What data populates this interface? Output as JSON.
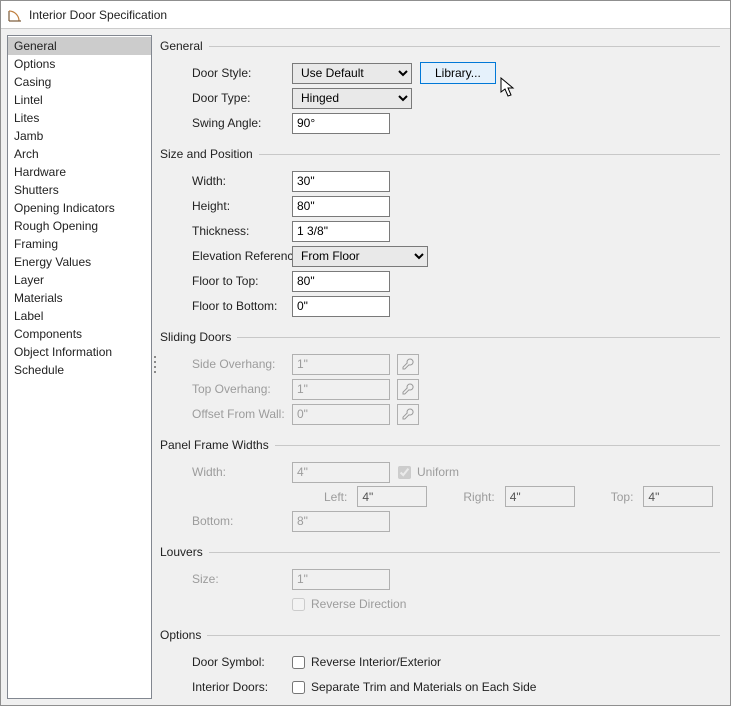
{
  "window": {
    "title": "Interior Door Specification"
  },
  "sidebar": {
    "items": [
      "General",
      "Options",
      "Casing",
      "Lintel",
      "Lites",
      "Jamb",
      "Arch",
      "Hardware",
      "Shutters",
      "Opening Indicators",
      "Rough Opening",
      "Framing",
      "Energy Values",
      "Layer",
      "Materials",
      "Label",
      "Components",
      "Object Information",
      "Schedule"
    ],
    "selected_index": 0
  },
  "groups": {
    "general": {
      "legend": "General",
      "door_style_label": "Door Style:",
      "door_style_value": "Use Default",
      "library_button": "Library...",
      "door_type_label": "Door Type:",
      "door_type_value": "Hinged",
      "swing_angle_label": "Swing Angle:",
      "swing_angle_value": "90°"
    },
    "size_position": {
      "legend": "Size and Position",
      "width_label": "Width:",
      "width_value": "30\"",
      "height_label": "Height:",
      "height_value": "80\"",
      "thickness_label": "Thickness:",
      "thickness_value": "1 3/8\"",
      "elev_ref_label": "Elevation Reference:",
      "elev_ref_value": "From Floor",
      "floor_to_top_label": "Floor to Top:",
      "floor_to_top_value": "80\"",
      "floor_to_bottom_label": "Floor to Bottom:",
      "floor_to_bottom_value": "0\""
    },
    "sliding": {
      "legend": "Sliding Doors",
      "side_overhang_label": "Side Overhang:",
      "side_overhang_value": "1\"",
      "top_overhang_label": "Top Overhang:",
      "top_overhang_value": "1\"",
      "offset_label": "Offset From Wall:",
      "offset_value": "0\""
    },
    "panel_frame": {
      "legend": "Panel Frame Widths",
      "width_label": "Width:",
      "width_value": "4\"",
      "uniform_label": "Uniform",
      "left_label": "Left:",
      "left_value": "4\"",
      "right_label": "Right:",
      "right_value": "4\"",
      "top_label": "Top:",
      "top_value": "4\"",
      "bottom_label": "Bottom:",
      "bottom_value": "8\""
    },
    "louvers": {
      "legend": "Louvers",
      "size_label": "Size:",
      "size_value": "1\"",
      "reverse_label": "Reverse Direction"
    },
    "options": {
      "legend": "Options",
      "door_symbol_label": "Door Symbol:",
      "reverse_ie_label": "Reverse Interior/Exterior",
      "interior_doors_label": "Interior Doors:",
      "separate_trim_label": "Separate Trim and Materials on Each Side"
    }
  }
}
